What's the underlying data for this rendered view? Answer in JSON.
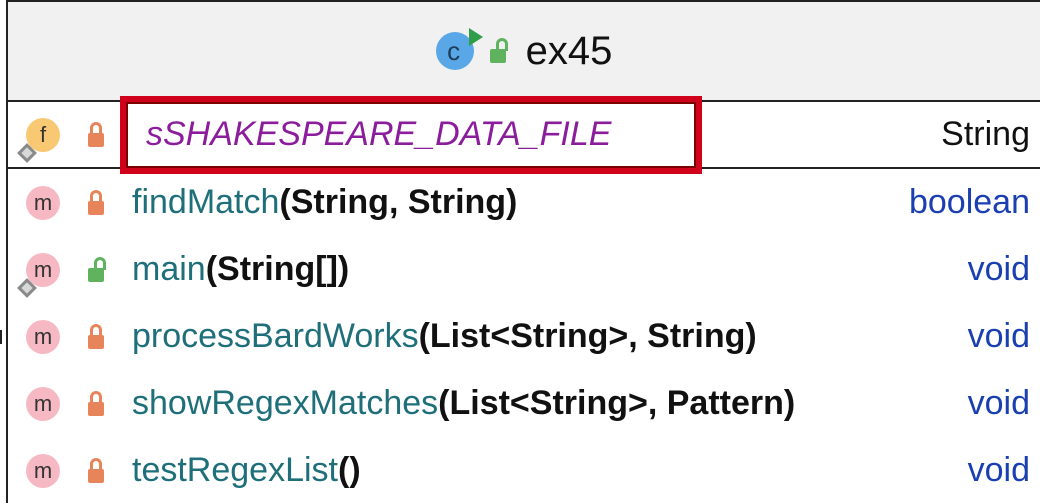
{
  "header": {
    "class_icon_letter": "c",
    "title": "ex45"
  },
  "members": [
    {
      "kind_letter": "f",
      "kind": "field",
      "visibility": "private",
      "override": true,
      "name": "sSHAKESPEARE_DATA_FILE",
      "params": "",
      "return_type": "String",
      "highlighted": true
    },
    {
      "kind_letter": "m",
      "kind": "method",
      "visibility": "private",
      "override": false,
      "name": "findMatch",
      "params": "(String, String)",
      "return_type": "boolean"
    },
    {
      "kind_letter": "m",
      "kind": "method",
      "visibility": "public",
      "override": true,
      "name": "main",
      "params": "(String[])",
      "return_type": "void"
    },
    {
      "kind_letter": "m",
      "kind": "method",
      "visibility": "private",
      "override": false,
      "name": "processBardWorks",
      "params": "(List<String>, String)",
      "return_type": "void"
    },
    {
      "kind_letter": "m",
      "kind": "method",
      "visibility": "private",
      "override": false,
      "name": "showRegexMatches",
      "params": "(List<String>, Pattern)",
      "return_type": "void"
    },
    {
      "kind_letter": "m",
      "kind": "method",
      "visibility": "private",
      "override": false,
      "name": "testRegexList",
      "params": "()",
      "return_type": "void"
    }
  ],
  "colors": {
    "field_badge": "#f8c972",
    "method_badge": "#f6b9c3",
    "private_lock": "#e8845a",
    "public_lock": "#5fb35f",
    "highlight_border": "#d0021b",
    "return_type_keyword": "#1a3fb0",
    "field_name": "#8b1d9c",
    "method_name": "#1f6f7a"
  },
  "icons": {
    "class": "class-run-icon",
    "field": "field-icon",
    "method": "method-icon",
    "private": "lock-closed-icon",
    "public": "lock-open-icon",
    "override": "override-marker-icon"
  }
}
